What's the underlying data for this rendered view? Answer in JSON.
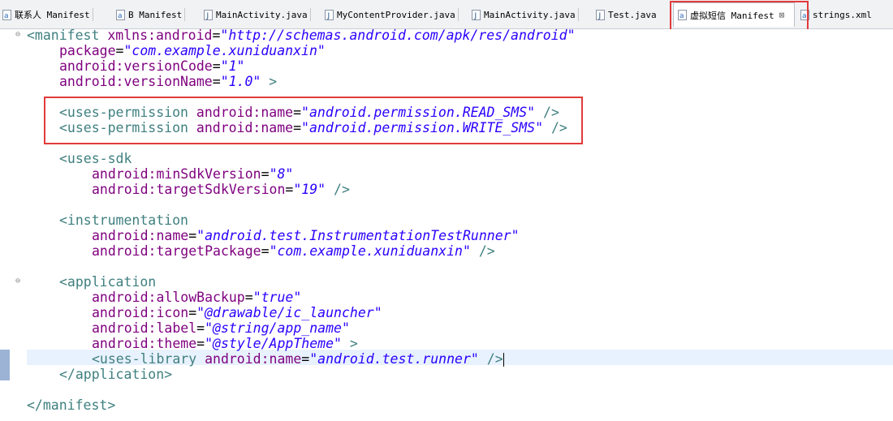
{
  "tabs": [
    {
      "label": "联系人 Manifest",
      "icon": "xml-manifest-icon",
      "active": false
    },
    {
      "label": "B Manifest",
      "icon": "xml-manifest-icon",
      "active": false
    },
    {
      "label": "MainActivity.java",
      "icon": "java-file-icon",
      "active": false
    },
    {
      "label": "MyContentProvider.java",
      "icon": "java-file-icon",
      "active": false
    },
    {
      "label": "MainActivity.java",
      "icon": "java-file-icon",
      "active": false
    },
    {
      "label": "Test.java",
      "icon": "java-file-icon",
      "active": false
    },
    {
      "label": "虚拟短信 Manifest",
      "icon": "xml-manifest-icon",
      "active": true
    },
    {
      "label": "strings.xml",
      "icon": "xml-file-icon",
      "active": false
    }
  ],
  "code": {
    "l1": {
      "tag": "<manifest",
      "attr": " xmlns:android",
      "eq": "=",
      "val": "\"http://schemas.android.com/apk/res/android\""
    },
    "l2": {
      "attr": "package",
      "eq": "=",
      "val": "\"com.example.xuniduanxin\""
    },
    "l3": {
      "attr": "android:versionCode",
      "eq": "=",
      "val": "\"1\""
    },
    "l4": {
      "attr": "android:versionName",
      "eq": "=",
      "val": "\"1.0\"",
      "close": " >"
    },
    "l6": {
      "tag": "<uses-permission",
      "attr": " android:name",
      "eq": "=",
      "val": "\"android.permission.READ_SMS\"",
      "close": " />"
    },
    "l7": {
      "tag": "<uses-permission",
      "attr": " android:name",
      "eq": "=",
      "val": "\"android.permission.WRITE_SMS\"",
      "close": " />"
    },
    "l9": {
      "tag": "<uses-sdk"
    },
    "l10": {
      "attr": "android:minSdkVersion",
      "eq": "=",
      "val": "\"8\""
    },
    "l11": {
      "attr": "android:targetSdkVersion",
      "eq": "=",
      "val": "\"19\"",
      "close": " />"
    },
    "l13": {
      "tag": "<instrumentation"
    },
    "l14": {
      "attr": "android:name",
      "eq": "=",
      "val": "\"android.test.InstrumentationTestRunner\""
    },
    "l15": {
      "attr": "android:targetPackage",
      "eq": "=",
      "val": "\"com.example.xuniduanxin\"",
      "close": " />"
    },
    "l17": {
      "tag": "<application"
    },
    "l18": {
      "attr": "android:allowBackup",
      "eq": "=",
      "val": "\"true\""
    },
    "l19": {
      "attr": "android:icon",
      "eq": "=",
      "val": "\"@drawable/ic_launcher\""
    },
    "l20": {
      "attr": "android:label",
      "eq": "=",
      "val": "\"@string/app_name\""
    },
    "l21": {
      "attr": "android:theme",
      "eq": "=",
      "val": "\"@style/AppTheme\"",
      "close": " >"
    },
    "l22": {
      "tag": "<uses-library",
      "attr": " android:name",
      "eq": "=",
      "val": "\"android.test.runner\"",
      "close": " />"
    },
    "l23": {
      "tag": "</application>"
    },
    "l25": {
      "tag": "</manifest>"
    }
  },
  "colors": {
    "highlight": "#e23b3b",
    "tag": "#3f7f7f",
    "attr": "#7f007f",
    "value": "#2a00ff"
  },
  "fold_marker": "⊖"
}
